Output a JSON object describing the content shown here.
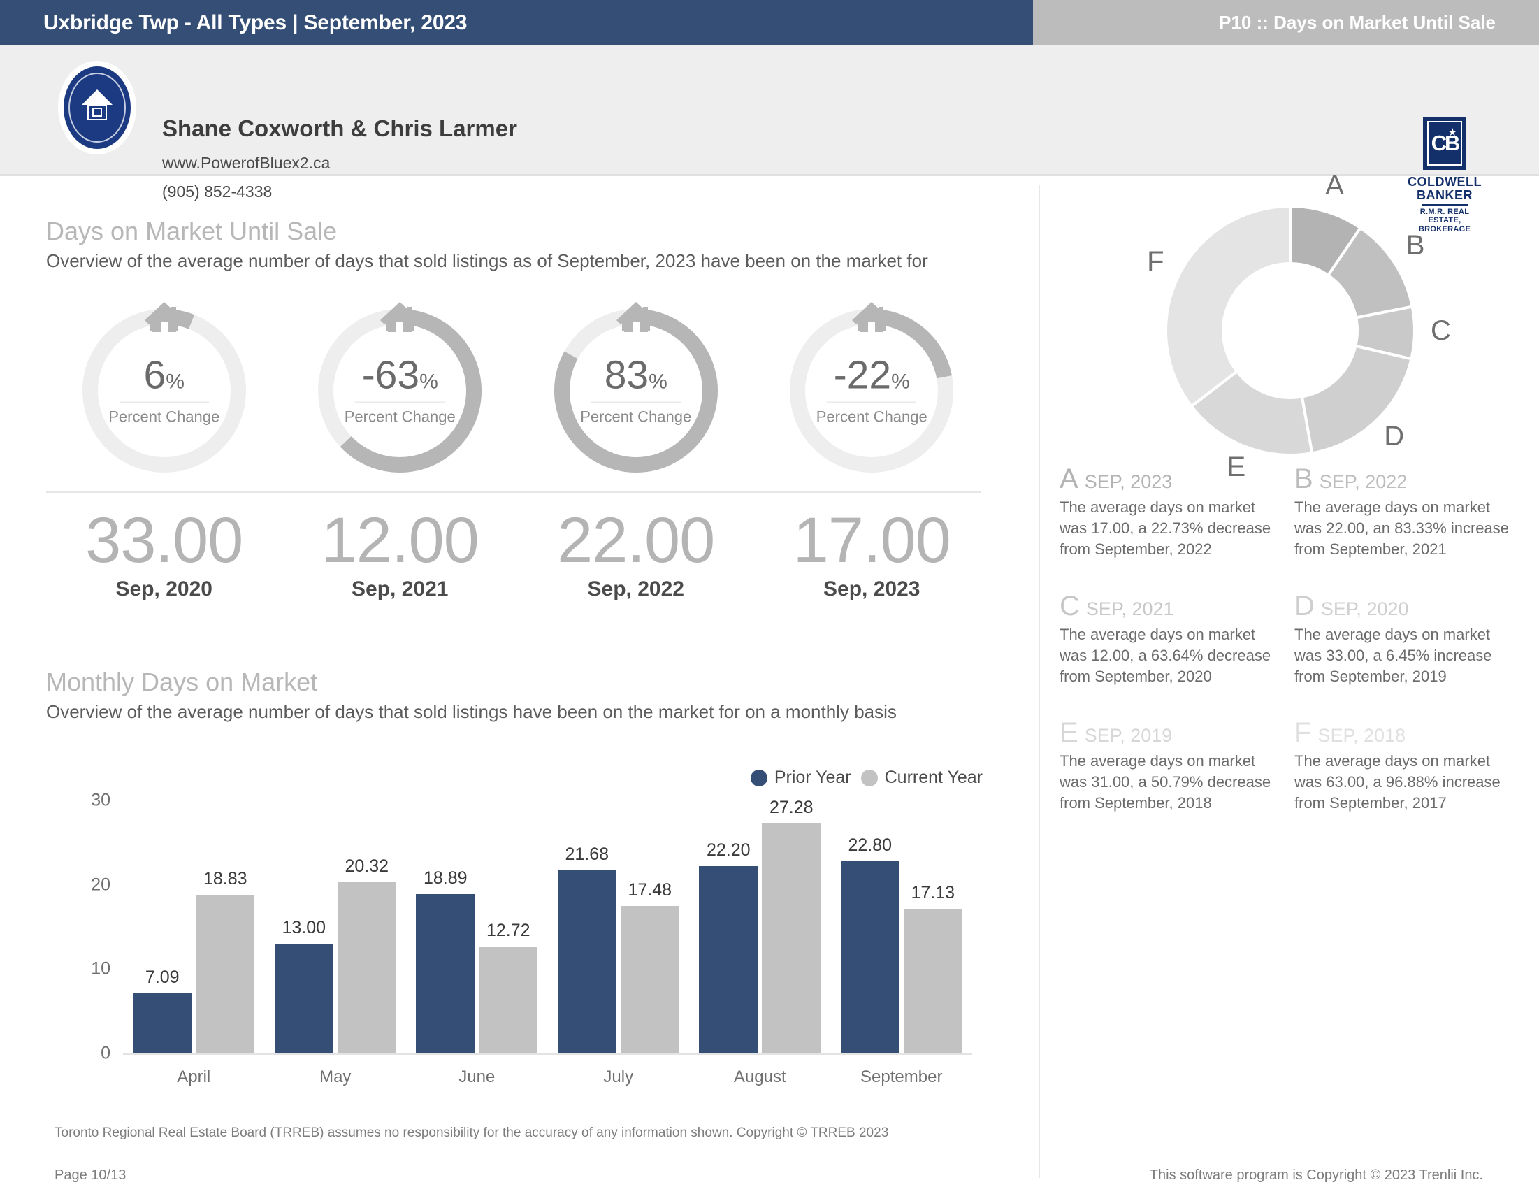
{
  "topbar": {
    "left_title": "Uxbridge Twp - All Types | September, 2023",
    "right_title": "P10 :: Days on Market Until Sale",
    "left_bg": "#344e76",
    "right_bg": "#bcbcbc"
  },
  "agent": {
    "name": "Shane Coxworth & Chris Larmer",
    "website": "www.PowerofBluex2.ca",
    "phone": "(905) 852-4338",
    "seal_icon": "house-seal-icon",
    "brokerage": {
      "mark": "CB",
      "line1": "COLDWELL",
      "line2": "BANKER",
      "sub1": "R.M.R. REAL ESTATE,",
      "sub2": "BROKERAGE"
    }
  },
  "dom_section": {
    "title": "Days on Market Until Sale",
    "subtitle": "Overview of the average number of days that sold listings as of September, 2023 have been on the market for",
    "gauges": [
      {
        "percent_text": "6",
        "suffix": "%",
        "label": "Percent Change",
        "arc_fraction": 0.06,
        "value": "33.00",
        "period": "Sep, 2020"
      },
      {
        "percent_text": "-63",
        "suffix": "%",
        "label": "Percent Change",
        "arc_fraction": 0.63,
        "value": "12.00",
        "period": "Sep, 2021"
      },
      {
        "percent_text": "83",
        "suffix": "%",
        "label": "Percent Change",
        "arc_fraction": 0.83,
        "value": "22.00",
        "period": "Sep, 2022"
      },
      {
        "percent_text": "-22",
        "suffix": "%",
        "label": "Percent Change",
        "arc_fraction": 0.22,
        "value": "17.00",
        "period": "Sep, 2023"
      }
    ]
  },
  "monthly_section": {
    "title": "Monthly Days on Market",
    "subtitle": "Overview of the average number of days that sold listings have been on the market for on a monthly basis",
    "legend": [
      {
        "label": "Prior Year",
        "color": "#344e76"
      },
      {
        "label": "Current Year",
        "color": "#c2c2c2"
      }
    ]
  },
  "chart_data": {
    "type": "bar",
    "title": "Monthly Days on Market",
    "xlabel": "",
    "ylabel": "",
    "ylim": [
      0,
      30
    ],
    "yticks": [
      0,
      10,
      20,
      30
    ],
    "grid": false,
    "legend_position": "top-right",
    "categories": [
      "April",
      "May",
      "June",
      "July",
      "August",
      "September"
    ],
    "series": [
      {
        "name": "Prior Year",
        "color": "#344e76",
        "values": [
          7.09,
          13.0,
          18.89,
          21.68,
          22.2,
          22.8
        ],
        "labels": [
          "7.09",
          "13.00",
          "18.89",
          "21.68",
          "22.20",
          "22.80"
        ]
      },
      {
        "name": "Current Year",
        "color": "#c2c2c2",
        "values": [
          18.83,
          20.32,
          12.72,
          17.48,
          27.28,
          17.13
        ],
        "labels": [
          "18.83",
          "20.32",
          "12.72",
          "17.48",
          "27.28",
          "17.13"
        ]
      }
    ]
  },
  "donut": {
    "type": "pie",
    "title": "",
    "labels": [
      "A",
      "B",
      "C",
      "D",
      "E",
      "F"
    ],
    "values": [
      17.0,
      22.0,
      12.0,
      33.0,
      31.0,
      63.0
    ],
    "colors": [
      "#b3b3b3",
      "#c0c0c0",
      "#c9c9c9",
      "#cfcfcf",
      "#d8d8d8",
      "#e4e4e4"
    ],
    "label_color": "#6f6f6f"
  },
  "cards": [
    {
      "letter": "A",
      "period": "SEP, 2023",
      "body": "The average days on market was 17.00, a 22.73% decrease from September, 2022",
      "letter_color": "#b3b3b3",
      "period_color": "#b3b3b3"
    },
    {
      "letter": "B",
      "period": "SEP, 2022",
      "body": "The average days on market was 22.00, an 83.33% increase from September, 2021",
      "letter_color": "#bdbdbd",
      "period_color": "#bdbdbd"
    },
    {
      "letter": "C",
      "period": "SEP, 2021",
      "body": "The average days on market was 12.00, a 63.64% decrease from September, 2020",
      "letter_color": "#c7c7c7",
      "period_color": "#c7c7c7"
    },
    {
      "letter": "D",
      "period": "SEP, 2020",
      "body": "The average days on market was 33.00, a 6.45% increase from September, 2019",
      "letter_color": "#cfcfcf",
      "period_color": "#cfcfcf"
    },
    {
      "letter": "E",
      "period": "SEP, 2019",
      "body": "The average days on market was 31.00, a 50.79% decrease from September, 2018",
      "letter_color": "#d7d7d7",
      "period_color": "#d7d7d7"
    },
    {
      "letter": "F",
      "period": "SEP, 2018",
      "body": "The average days on market was 63.00, a 96.88% increase from September, 2017",
      "letter_color": "#e0e0e0",
      "period_color": "#e0e0e0"
    }
  ],
  "footer": {
    "disclaimer": "Toronto Regional Real Estate Board (TRREB) assumes no responsibility for the accuracy of any information shown. Copyright © TRREB 2023",
    "page": "Page 10/13",
    "copyright": "This software program is Copyright © 2023 Trenlii Inc."
  }
}
